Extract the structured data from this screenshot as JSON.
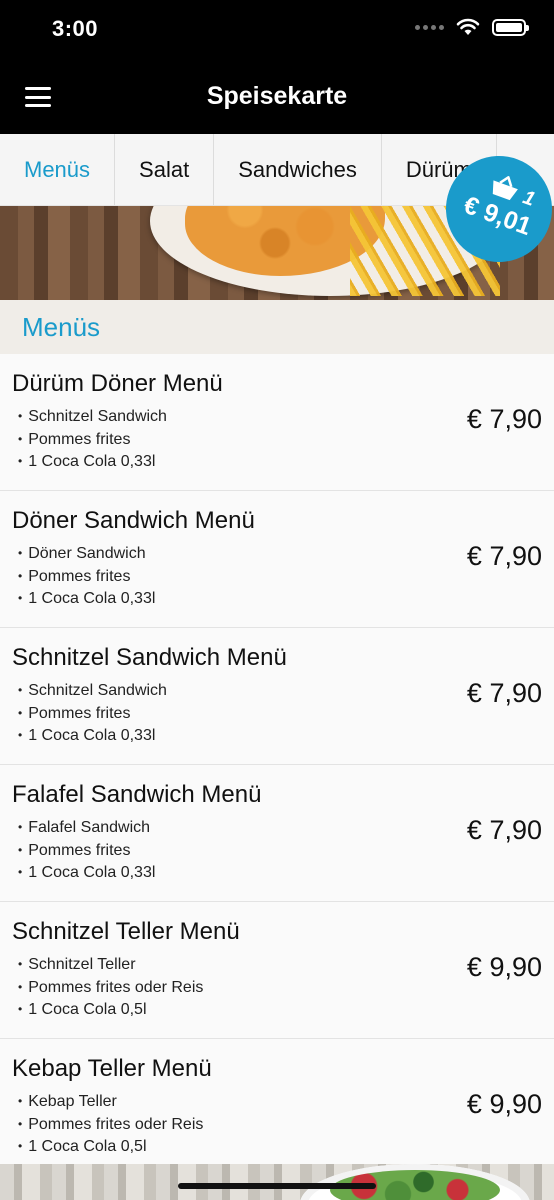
{
  "status_bar": {
    "time": "3:00"
  },
  "navbar": {
    "title": "Speisekarte",
    "menu_icon": "hamburger-icon"
  },
  "tabs": [
    {
      "label": "Menüs",
      "active": true
    },
    {
      "label": "Salat",
      "active": false
    },
    {
      "label": "Sandwiches",
      "active": false
    },
    {
      "label": "Dürüm",
      "active": false
    }
  ],
  "cart": {
    "count": "1",
    "total": "€ 9,01",
    "icon": "basket-icon"
  },
  "section": {
    "title": "Menüs"
  },
  "items": [
    {
      "name": "Dürüm Döner Menü",
      "desc": [
        "Schnitzel Sandwich",
        "Pommes frites",
        "1 Coca Cola 0,33l"
      ],
      "price": "€ 7,90"
    },
    {
      "name": "Döner Sandwich Menü",
      "desc": [
        "Döner Sandwich",
        "Pommes frites",
        "1 Coca Cola 0,33l"
      ],
      "price": "€ 7,90"
    },
    {
      "name": "Schnitzel Sandwich Menü",
      "desc": [
        "Schnitzel Sandwich",
        "Pommes frites",
        "1 Coca Cola 0,33l"
      ],
      "price": "€ 7,90"
    },
    {
      "name": "Falafel Sandwich Menü",
      "desc": [
        "Falafel Sandwich",
        "Pommes frites",
        "1 Coca Cola 0,33l"
      ],
      "price": "€ 7,90"
    },
    {
      "name": "Schnitzel Teller Menü",
      "desc": [
        "Schnitzel Teller",
        "Pommes frites oder Reis",
        "1 Coca Cola 0,5l"
      ],
      "price": "€ 9,90"
    },
    {
      "name": "Kebap Teller Menü",
      "desc": [
        "Kebap Teller",
        "Pommes frites oder Reis",
        "1 Coca Cola 0,5l"
      ],
      "price": "€ 9,90"
    }
  ],
  "colors": {
    "accent": "#1a9bcb",
    "bar": "#000000"
  }
}
